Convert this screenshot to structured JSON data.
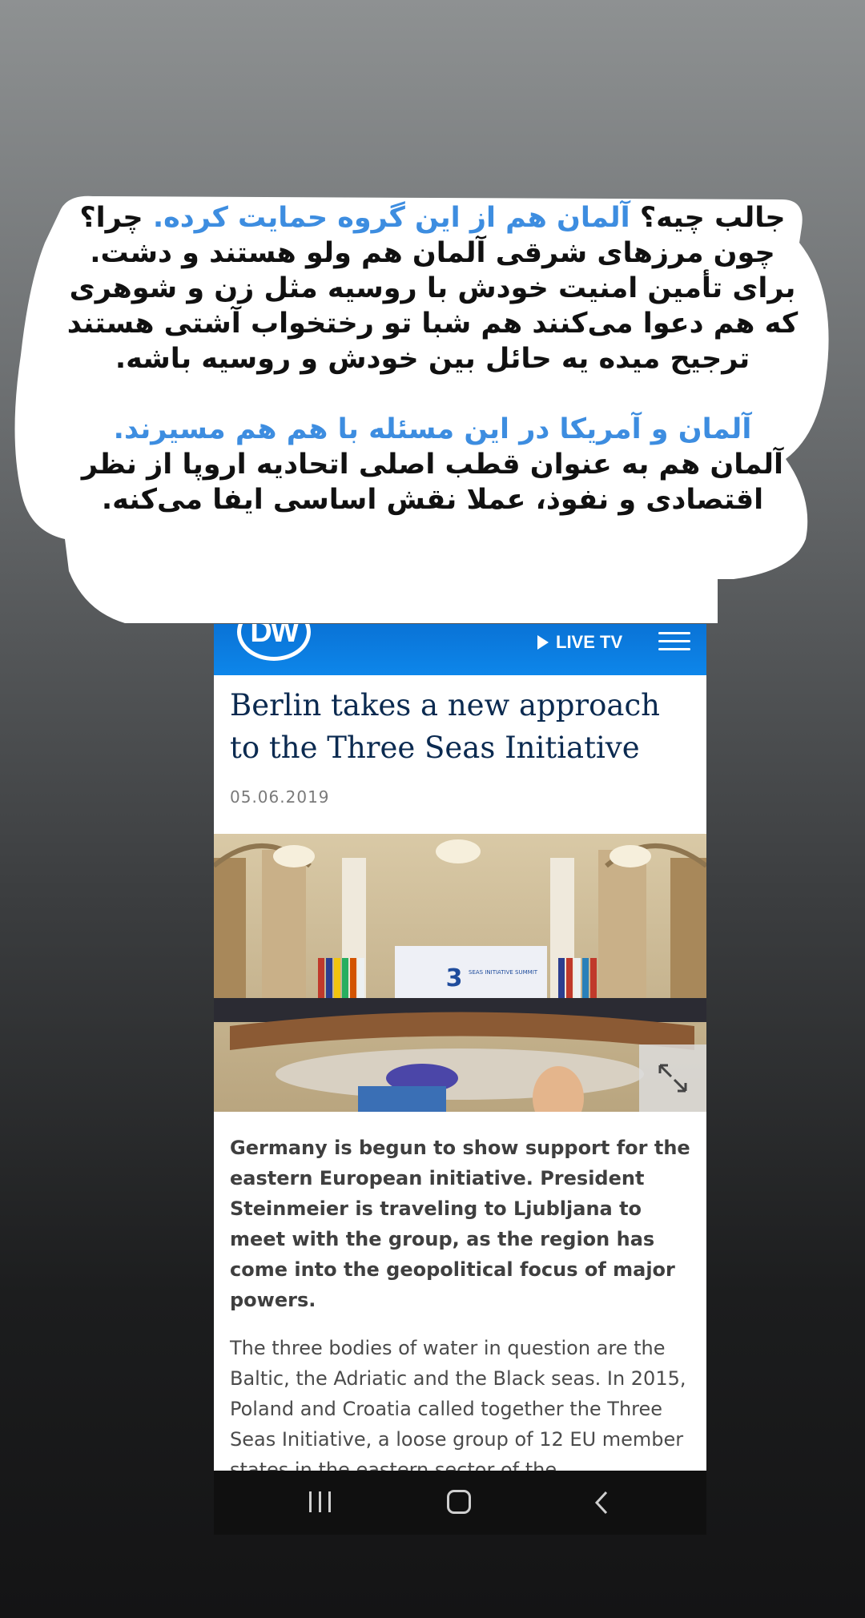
{
  "caption": {
    "p1_start": "جالب چیه؟",
    "p1_highlight": "آلمان هم از این گروه حمایت کرده.",
    "p1_rest": "چرا؟ چون مرزهای شرقی آلمان هم ولو هستند و دشت. برای تأمین امنیت خودش با روسیه مثل زن و شوهری که هم دعوا می‌کنند هم شبا تو رختخواب آشتی هستند ترجیح میده یه حائل بین خودش و روسیه باشه.",
    "p2_highlight": "آلمان و آمریکا در این مسئله با هم هم مسیرند.",
    "p2_rest": "آلمان هم به عنوان قطب اصلی اتحادیه اروپا از نظر اقتصادی و نفوذ، عملا نقش اساسی ایفا می‌کنه.",
    "highlight_color": "#3d8de0"
  },
  "header": {
    "logo": "DW",
    "live_tv": "LIVE TV",
    "brand_color": "#0d86ea"
  },
  "article": {
    "title": "Berlin takes a new approach to the Three Seas Initiative",
    "date": "05.06.2019",
    "image_banner": "SEAS INITIATIVE SUMMIT",
    "image_number": "3",
    "lead": "Germany is begun to show support for the eastern European initiative. President Steinmeier is traveling to Ljubljana to meet with the group, as the region has come into the geopolitical focus of major powers.",
    "body": "The three bodies of water in question are the Baltic, the Adriatic and the Black seas. In 2015, Poland and Croatia called together the Three Seas Initiative, a loose group of 12 EU member states in the eastern sector of the"
  },
  "nav": {
    "recents_icon": "recents-icon",
    "home_icon": "home-icon",
    "back_icon": "back-icon"
  }
}
